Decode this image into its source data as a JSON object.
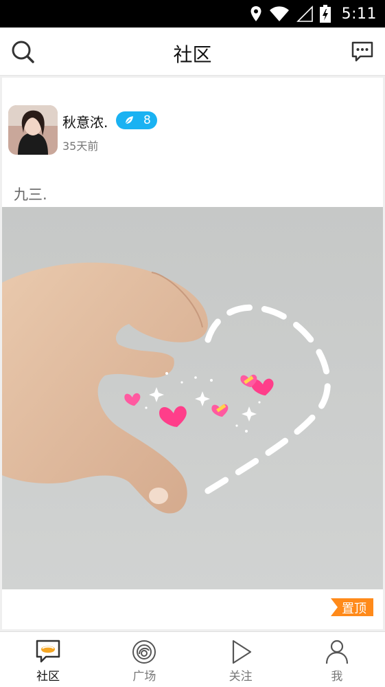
{
  "status_bar": {
    "time": "5:11"
  },
  "header": {
    "title": "社区"
  },
  "post": {
    "username": "秋意浓.",
    "level": "8",
    "time_ago": "35天前",
    "text": "九三.",
    "pin_label": "置顶"
  },
  "tabs": [
    {
      "label": "社区",
      "icon": "community-icon",
      "active": true
    },
    {
      "label": "广场",
      "icon": "plaza-icon",
      "active": false
    },
    {
      "label": "关注",
      "icon": "play-icon",
      "active": false
    },
    {
      "label": "我",
      "icon": "person-icon",
      "active": false
    }
  ],
  "colors": {
    "accent": "#1ab2f2",
    "pin": "#ff8a1a",
    "tab_active": "#f5a623"
  }
}
